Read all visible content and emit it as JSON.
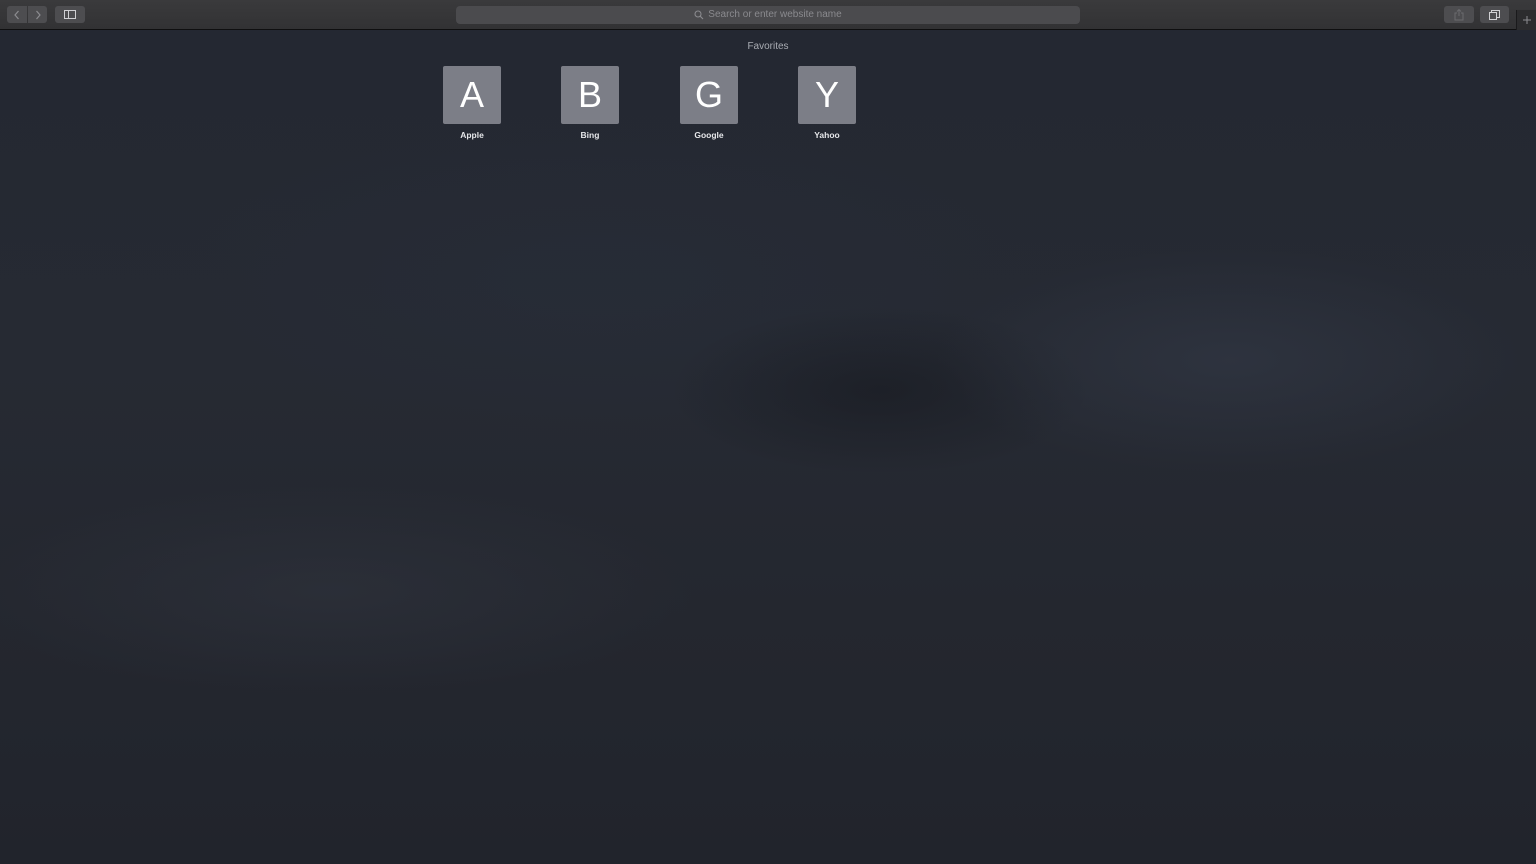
{
  "toolbar": {
    "address_placeholder": "Search or enter website name",
    "icons": [
      "chevron-left-icon",
      "chevron-right-icon",
      "sidebar-icon",
      "search-icon",
      "share-icon",
      "tabs-overview-icon",
      "plus-icon"
    ]
  },
  "favorites": {
    "title": "Favorites",
    "items": [
      {
        "letter": "A",
        "label": "Apple"
      },
      {
        "letter": "B",
        "label": "Bing"
      },
      {
        "letter": "G",
        "label": "Google"
      },
      {
        "letter": "Y",
        "label": "Yahoo"
      }
    ]
  },
  "colors": {
    "background": "#22252e",
    "toolbar": "#363638",
    "tile": "#7c7e87"
  }
}
